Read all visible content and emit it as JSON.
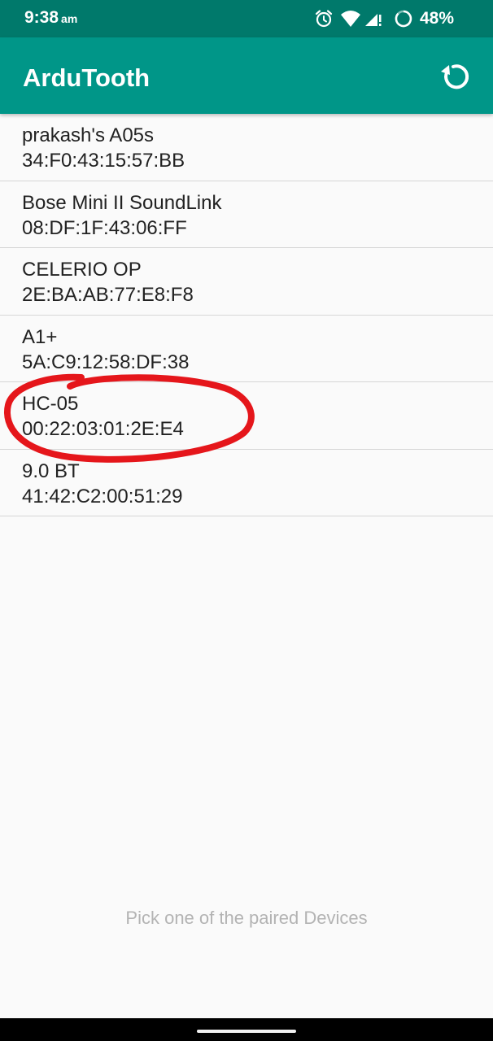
{
  "status_bar": {
    "time": "9:38",
    "ampm": "am",
    "battery_percent": "48%",
    "icons": [
      "alarm-icon",
      "wifi-icon",
      "signal-icon",
      "battery-saver-icon"
    ]
  },
  "app_bar": {
    "title": "ArduTooth",
    "refresh_icon": "refresh-icon"
  },
  "devices": [
    {
      "name": "prakash's A05s",
      "mac": "34:F0:43:15:57:BB"
    },
    {
      "name": "Bose Mini II SoundLink",
      "mac": "08:DF:1F:43:06:FF"
    },
    {
      "name": "CELERIO OP",
      "mac": "2E:BA:AB:77:E8:F8"
    },
    {
      "name": "A1+",
      "mac": "5A:C9:12:58:DF:38"
    },
    {
      "name": "HC-05",
      "mac": "00:22:03:01:2E:E4"
    },
    {
      "name": "9.0 BT",
      "mac": "41:42:C2:00:51:29"
    }
  ],
  "highlighted_device": "HC-05",
  "annotation_color": "#e5161b",
  "hint": "Pick one of the paired Devices",
  "colors": {
    "status_bar": "#00796b",
    "app_bar": "#009688",
    "background": "#fafafa"
  }
}
